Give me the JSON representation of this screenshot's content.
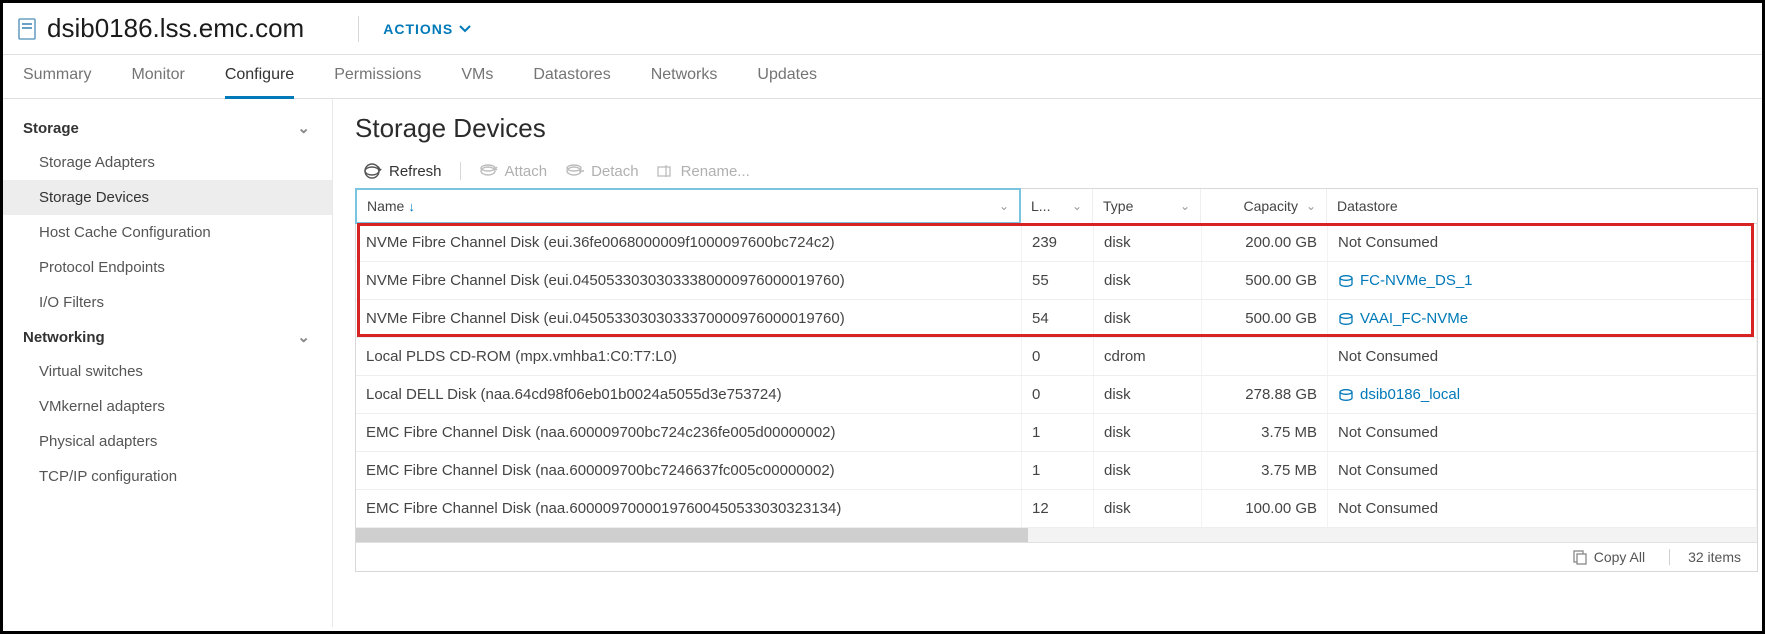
{
  "header": {
    "host_name": "dsib0186.lss.emc.com",
    "actions_label": "ACTIONS"
  },
  "tabs": [
    {
      "label": "Summary",
      "active": false
    },
    {
      "label": "Monitor",
      "active": false
    },
    {
      "label": "Configure",
      "active": true
    },
    {
      "label": "Permissions",
      "active": false
    },
    {
      "label": "VMs",
      "active": false
    },
    {
      "label": "Datastores",
      "active": false
    },
    {
      "label": "Networks",
      "active": false
    },
    {
      "label": "Updates",
      "active": false
    }
  ],
  "sidebar": {
    "sections": [
      {
        "title": "Storage",
        "expanded": true,
        "items": [
          {
            "label": "Storage Adapters",
            "active": false
          },
          {
            "label": "Storage Devices",
            "active": true
          },
          {
            "label": "Host Cache Configuration",
            "active": false
          },
          {
            "label": "Protocol Endpoints",
            "active": false
          },
          {
            "label": "I/O Filters",
            "active": false
          }
        ]
      },
      {
        "title": "Networking",
        "expanded": true,
        "items": [
          {
            "label": "Virtual switches",
            "active": false
          },
          {
            "label": "VMkernel adapters",
            "active": false
          },
          {
            "label": "Physical adapters",
            "active": false
          },
          {
            "label": "TCP/IP configuration",
            "active": false
          }
        ]
      }
    ]
  },
  "main": {
    "title": "Storage Devices",
    "toolbar": {
      "refresh": "Refresh",
      "attach": "Attach",
      "detach": "Detach",
      "rename": "Rename..."
    },
    "columns": {
      "name": "Name",
      "lun": "L...",
      "type": "Type",
      "capacity": "Capacity",
      "datastore": "Datastore"
    },
    "rows": [
      {
        "name": "NVMe Fibre Channel Disk (eui.36fe0068000009f1000097600bc724c2)",
        "lun": "239",
        "type": "disk",
        "capacity": "200.00 GB",
        "datastore": "Not Consumed",
        "link": false,
        "hl": true
      },
      {
        "name": "NVMe Fibre Channel Disk (eui.04505330303033380000976000019760)",
        "lun": "55",
        "type": "disk",
        "capacity": "500.00 GB",
        "datastore": "FC-NVMe_DS_1",
        "link": true,
        "hl": true
      },
      {
        "name": "NVMe Fibre Channel Disk (eui.04505330303033370000976000019760)",
        "lun": "54",
        "type": "disk",
        "capacity": "500.00 GB",
        "datastore": "VAAI_FC-NVMe",
        "link": true,
        "hl": true
      },
      {
        "name": "Local PLDS CD-ROM (mpx.vmhba1:C0:T7:L0)",
        "lun": "0",
        "type": "cdrom",
        "capacity": "",
        "datastore": "Not Consumed",
        "link": false
      },
      {
        "name": "Local DELL Disk (naa.64cd98f06eb01b0024a5055d3e753724)",
        "lun": "0",
        "type": "disk",
        "capacity": "278.88 GB",
        "datastore": "dsib0186_local",
        "link": true
      },
      {
        "name": "EMC Fibre Channel Disk (naa.600009700bc724c236fe005d00000002)",
        "lun": "1",
        "type": "disk",
        "capacity": "3.75 MB",
        "datastore": "Not Consumed",
        "link": false
      },
      {
        "name": "EMC Fibre Channel Disk (naa.600009700bc7246637fc005c00000002)",
        "lun": "1",
        "type": "disk",
        "capacity": "3.75 MB",
        "datastore": "Not Consumed",
        "link": false
      },
      {
        "name": "EMC Fibre Channel Disk (naa.60000970000197600450533030323134)",
        "lun": "12",
        "type": "disk",
        "capacity": "100.00 GB",
        "datastore": "Not Consumed",
        "link": false
      }
    ],
    "footer": {
      "copy_all": "Copy All",
      "item_count": "32 items"
    }
  }
}
